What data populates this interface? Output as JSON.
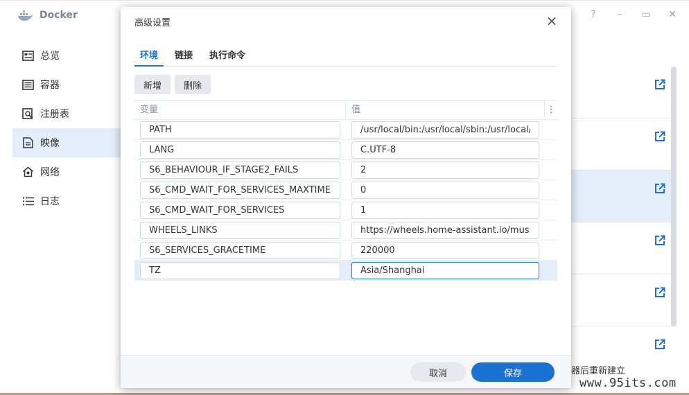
{
  "app": {
    "title": "Docker",
    "window_controls": [
      "?",
      "–",
      "▭",
      "✕"
    ]
  },
  "sidebar": {
    "items": [
      {
        "label": "总览",
        "icon": "overview-icon"
      },
      {
        "label": "容器",
        "icon": "container-icon"
      },
      {
        "label": "注册表",
        "icon": "registry-icon"
      },
      {
        "label": "映像",
        "icon": "image-icon",
        "active": true
      },
      {
        "label": "网络",
        "icon": "network-icon"
      },
      {
        "label": "日志",
        "icon": "log-icon"
      }
    ]
  },
  "background": {
    "note": "器后重新建立",
    "watermark": "www.95its.com"
  },
  "modal": {
    "title": "高级设置",
    "close": "×",
    "tabs": [
      {
        "label": "环境",
        "active": true
      },
      {
        "label": "链接"
      },
      {
        "label": "执行命令"
      }
    ],
    "toolbar": {
      "add": "新增",
      "delete": "删除"
    },
    "grid": {
      "headers": {
        "variable": "变量",
        "value": "值",
        "menu": "⋮"
      },
      "rows": [
        {
          "variable": "PATH",
          "value": "/usr/local/bin:/usr/local/sbin:/usr/local/bin:/usr/sbin:/usr/bin:/sbin:/bin"
        },
        {
          "variable": "LANG",
          "value": "C.UTF-8"
        },
        {
          "variable": "S6_BEHAVIOUR_IF_STAGE2_FAILS",
          "value": "2"
        },
        {
          "variable": "S6_CMD_WAIT_FOR_SERVICES_MAXTIME",
          "value": "0"
        },
        {
          "variable": "S6_CMD_WAIT_FOR_SERVICES",
          "value": "1"
        },
        {
          "variable": "WHEELS_LINKS",
          "value": "https://wheels.home-assistant.io/musllinux/"
        },
        {
          "variable": "S6_SERVICES_GRACETIME",
          "value": "220000"
        },
        {
          "variable": "TZ",
          "value": "Asia/Shanghai",
          "selected": true
        }
      ]
    },
    "footer": {
      "cancel": "取消",
      "save": "保存"
    }
  },
  "colors": {
    "accent": "#1a73d4",
    "selected_row": "#e4eefb"
  }
}
